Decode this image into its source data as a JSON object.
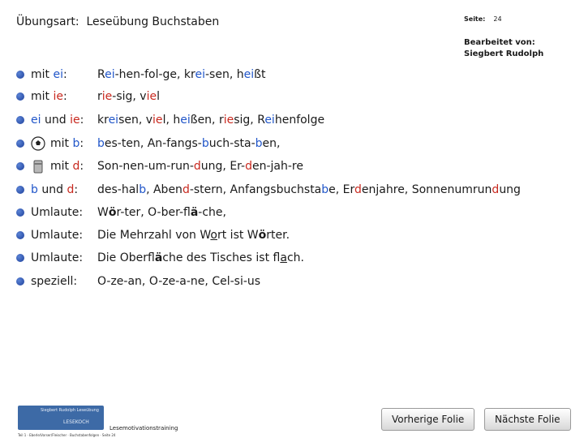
{
  "header": {
    "title": "Übungsart:  Leseübung Buchstaben",
    "seite_label": "Seite:",
    "seite_num": "24",
    "bearbeitet_label": "Bearbeitet von:",
    "author": "Siegbert Rudolph"
  },
  "rows": [
    {
      "label": [
        {
          "t": "mit "
        },
        {
          "t": "ei",
          "c": "hl"
        },
        {
          "t": ":"
        }
      ],
      "value": [
        {
          "t": "R"
        },
        {
          "t": "ei",
          "c": "hl"
        },
        {
          "t": "-hen-fol-ge, kr"
        },
        {
          "t": "ei",
          "c": "hl"
        },
        {
          "t": "-sen, h"
        },
        {
          "t": "ei",
          "c": "hl"
        },
        {
          "t": "ßt"
        }
      ]
    },
    {
      "label": [
        {
          "t": "mit "
        },
        {
          "t": "ie",
          "c": "hr"
        },
        {
          "t": ":"
        }
      ],
      "value": [
        {
          "t": "r"
        },
        {
          "t": "ie",
          "c": "hr"
        },
        {
          "t": "-sig, v"
        },
        {
          "t": "ie",
          "c": "hr"
        },
        {
          "t": "l"
        }
      ]
    },
    {
      "label": [
        {
          "t": "ei",
          "c": "hl"
        },
        {
          "t": " und "
        },
        {
          "t": "ie",
          "c": "hr"
        },
        {
          "t": ":"
        }
      ],
      "value": [
        {
          "t": "kr"
        },
        {
          "t": "ei",
          "c": "hl"
        },
        {
          "t": "sen, v"
        },
        {
          "t": "ie",
          "c": "hr"
        },
        {
          "t": "l, h"
        },
        {
          "t": "ei",
          "c": "hl"
        },
        {
          "t": "ßen, r"
        },
        {
          "t": "ie",
          "c": "hr"
        },
        {
          "t": "sig, R"
        },
        {
          "t": "ei",
          "c": "hl"
        },
        {
          "t": "henfolge"
        }
      ]
    },
    {
      "icon": "ball",
      "label": [
        {
          "t": "mit "
        },
        {
          "t": "b",
          "c": "hl"
        },
        {
          "t": ":"
        }
      ],
      "value": [
        {
          "t": "b",
          "c": "hl"
        },
        {
          "t": "es-ten, An-fangs-"
        },
        {
          "t": "b",
          "c": "hl"
        },
        {
          "t": "uch-sta-"
        },
        {
          "t": "b",
          "c": "hl"
        },
        {
          "t": "en,"
        }
      ]
    },
    {
      "icon": "can",
      "label": [
        {
          "t": "mit "
        },
        {
          "t": "d",
          "c": "hr"
        },
        {
          "t": ":"
        }
      ],
      "value": [
        {
          "t": "Son-nen-um-run-"
        },
        {
          "t": "d",
          "c": "hr"
        },
        {
          "t": "ung, Er-"
        },
        {
          "t": "d",
          "c": "hr"
        },
        {
          "t": "en-jah-re"
        }
      ]
    },
    {
      "label": [
        {
          "t": "b",
          "c": "hl"
        },
        {
          "t": " und "
        },
        {
          "t": "d",
          "c": "hr"
        },
        {
          "t": ":"
        }
      ],
      "value": [
        {
          "t": "des-hal"
        },
        {
          "t": "b",
          "c": "hl"
        },
        {
          "t": ", Aben"
        },
        {
          "t": "d",
          "c": "hr"
        },
        {
          "t": "-stern, Anfangsbuchsta"
        },
        {
          "t": "b",
          "c": "hl"
        },
        {
          "t": "e, Er"
        },
        {
          "t": "d",
          "c": "hr"
        },
        {
          "t": "enjahre, Sonnenumrun"
        },
        {
          "t": "d",
          "c": "hr"
        },
        {
          "t": "ung"
        }
      ]
    },
    {
      "label": [
        {
          "t": "Umlaute:"
        }
      ],
      "value": [
        {
          "t": "W"
        },
        {
          "t": "ö",
          "c": "bold"
        },
        {
          "t": "r-ter, O-ber-fl"
        },
        {
          "t": "ä",
          "c": "bold"
        },
        {
          "t": "-che,"
        }
      ]
    },
    {
      "label": [
        {
          "t": "Umlaute:"
        }
      ],
      "value": [
        {
          "t": "Die Mehrzahl von W"
        },
        {
          "t": "o",
          "c": "u"
        },
        {
          "t": "rt ist W"
        },
        {
          "t": "ö",
          "c": "bold"
        },
        {
          "t": "rter."
        }
      ]
    },
    {
      "label": [
        {
          "t": "Umlaute:"
        }
      ],
      "value": [
        {
          "t": "Die Oberfl"
        },
        {
          "t": "ä",
          "c": "bold"
        },
        {
          "t": "che des Tisches ist fl"
        },
        {
          "t": "a",
          "c": "u"
        },
        {
          "t": "ch."
        }
      ]
    },
    {
      "label": [
        {
          "t": "speziell:"
        }
      ],
      "value": [
        {
          "t": "O-ze-an, O-ze-a-ne, Cel-si-us"
        }
      ]
    }
  ],
  "footer": {
    "logo_line1": "Siegbert Rudolph Leseübung",
    "logo_line2": "LESEKOCH",
    "title": "Lesemotivationstraining",
    "source": "Teil 1 · Eberle/Vorser/Fleischer · Buchstabenfolgen · Seite 24",
    "prev_label": "Vorherige Folie",
    "next_label": "Nächste Folie"
  }
}
